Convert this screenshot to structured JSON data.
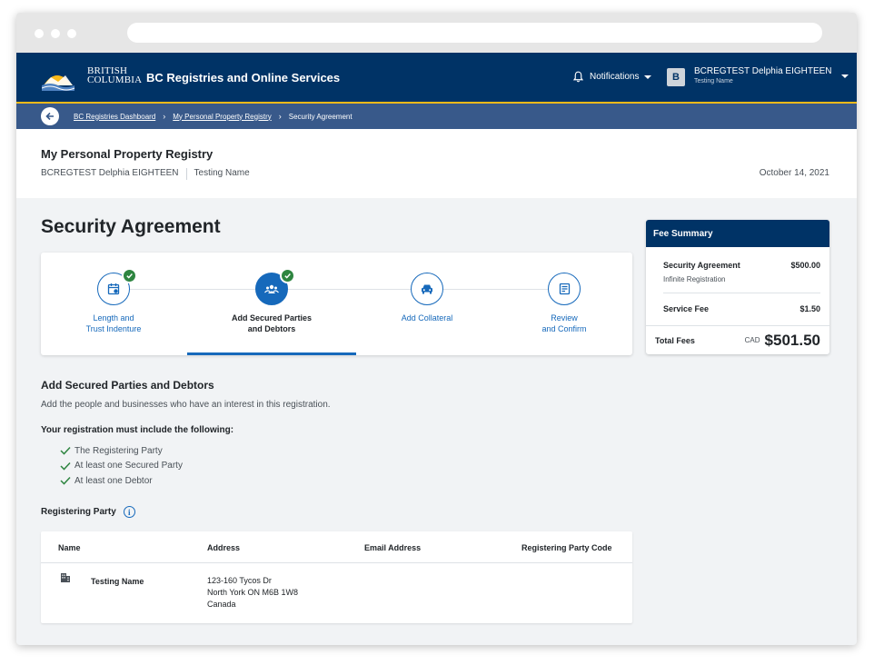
{
  "header": {
    "logo_line1": "BRITISH",
    "logo_line2": "COLUMBIA",
    "app_title": "BC Registries and Online Services",
    "notifications_label": "Notifications",
    "account": {
      "initial": "B",
      "name": "BCREGTEST Delphia EIGHTEEN",
      "subtitle": "Testing Name"
    }
  },
  "breadcrumb": {
    "items": [
      "BC Registries Dashboard",
      "My Personal Property Registry"
    ],
    "current": "Security Agreement"
  },
  "subheader": {
    "title": "My Personal Property Registry",
    "user": "BCREGTEST Delphia EIGHTEEN",
    "account_name": "Testing Name",
    "date": "October 14, 2021"
  },
  "page_title": "Security Agreement",
  "steps": [
    {
      "line1": "Length and",
      "line2": "Trust Indenture",
      "icon": "calendar-icon",
      "complete": true
    },
    {
      "line1": "Add Secured Parties",
      "line2": "and Debtors",
      "icon": "people-icon",
      "complete": true,
      "active": true
    },
    {
      "line1": "Add Collateral",
      "line2": "",
      "icon": "car-icon",
      "complete": false
    },
    {
      "line1": "Review",
      "line2": "and Confirm",
      "icon": "document-icon",
      "complete": false
    }
  ],
  "fee_summary": {
    "title": "Fee Summary",
    "item_label": "Security Agreement",
    "item_amount": "$500.00",
    "item_sub": "Infinite Registration",
    "service_label": "Service Fee",
    "service_amount": "$1.50",
    "total_label": "Total Fees",
    "currency": "CAD",
    "total_amount": "$501.50"
  },
  "section": {
    "title": "Add Secured Parties and Debtors",
    "description": "Add the people and businesses who have an interest in this registration.",
    "requirements_title": "Your registration must include the following:",
    "requirements": [
      "The Registering Party",
      "At least one Secured Party",
      "At least one Debtor"
    ]
  },
  "registering_party": {
    "label": "Registering Party",
    "columns": [
      "Name",
      "Address",
      "Email Address",
      "Registering Party Code"
    ],
    "row": {
      "name": "Testing Name",
      "address": [
        "123-160 Tycos Dr",
        "North York ON M6B 1W8",
        "Canada"
      ],
      "email": "",
      "code": ""
    }
  },
  "colors": {
    "primary": "#003366",
    "accent": "#fcba19",
    "link": "#1669bb",
    "success": "#2e8540",
    "breadcrumb": "#38598a"
  }
}
